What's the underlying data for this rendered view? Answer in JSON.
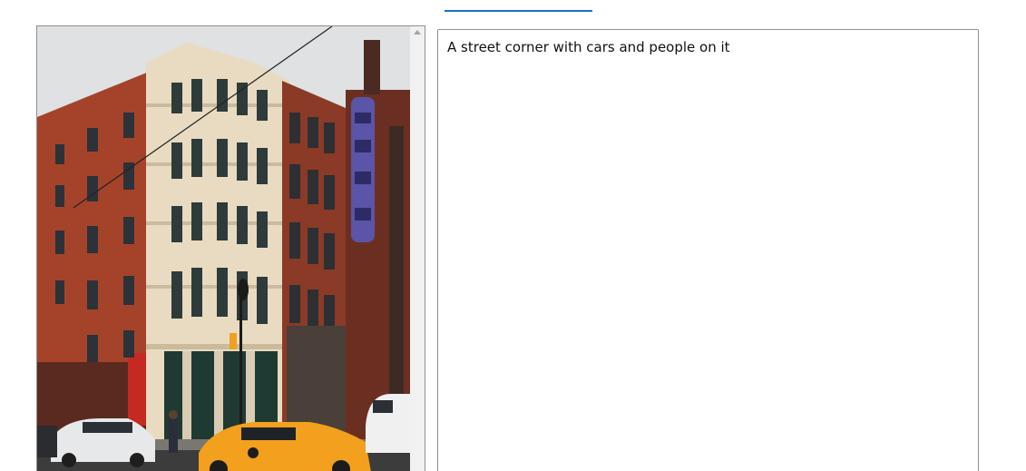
{
  "caption": {
    "text": "A street corner with cars and people on it"
  },
  "image": {
    "subject": "street-corner-photo"
  },
  "colors": {
    "tab_indicator": "#1a73c9",
    "taxi": "#f2a01e",
    "brick": "#a8452b",
    "cream_facade": "#e9dcc3"
  }
}
